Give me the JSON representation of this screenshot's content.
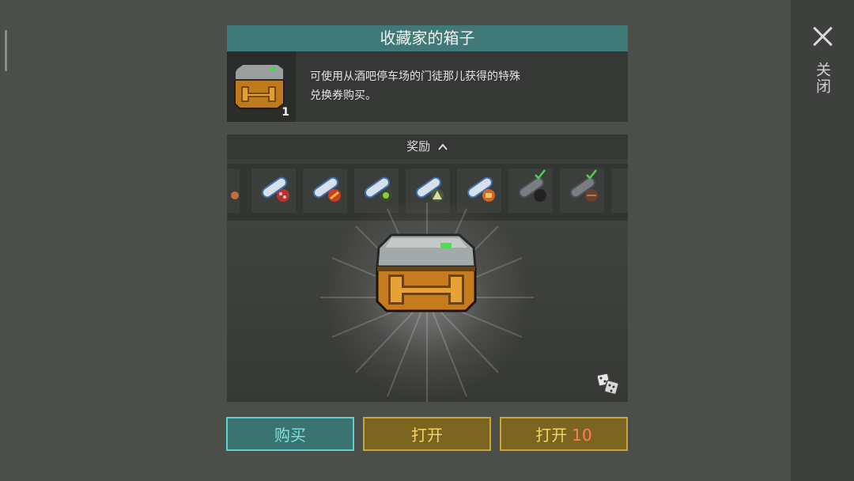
{
  "header": {
    "title": "收藏家的箱子"
  },
  "chest_info": {
    "count": "1",
    "description_line1": "可使用从酒吧停车场的门徒那儿获得的特殊",
    "description_line2": "兑换券购买。"
  },
  "rewards": {
    "header_label": "奖励",
    "items": [
      {
        "icon": "partial-blueprint-icon",
        "owned": false
      },
      {
        "icon": "blueprint-red-dots-icon",
        "owned": false
      },
      {
        "icon": "blueprint-red-slash-icon",
        "owned": false
      },
      {
        "icon": "blueprint-green-icon",
        "owned": false
      },
      {
        "icon": "blueprint-triangle-icon",
        "owned": false
      },
      {
        "icon": "blueprint-orange-icon",
        "owned": false
      },
      {
        "icon": "blueprint-owned-dark-icon",
        "owned": true
      },
      {
        "icon": "blueprint-owned-brown-icon",
        "owned": true
      }
    ]
  },
  "buttons": {
    "buy_label": "购买",
    "open_label": "打开",
    "open10_label": "打开",
    "open10_count": "10"
  },
  "side": {
    "close_label": "关闭"
  },
  "colors": {
    "background": "#4c4e4a",
    "title_bar": "#3f7a78",
    "buy_button": "#3b7370",
    "open_button": "#7a6420",
    "accent_count": "#ff7d5a"
  }
}
